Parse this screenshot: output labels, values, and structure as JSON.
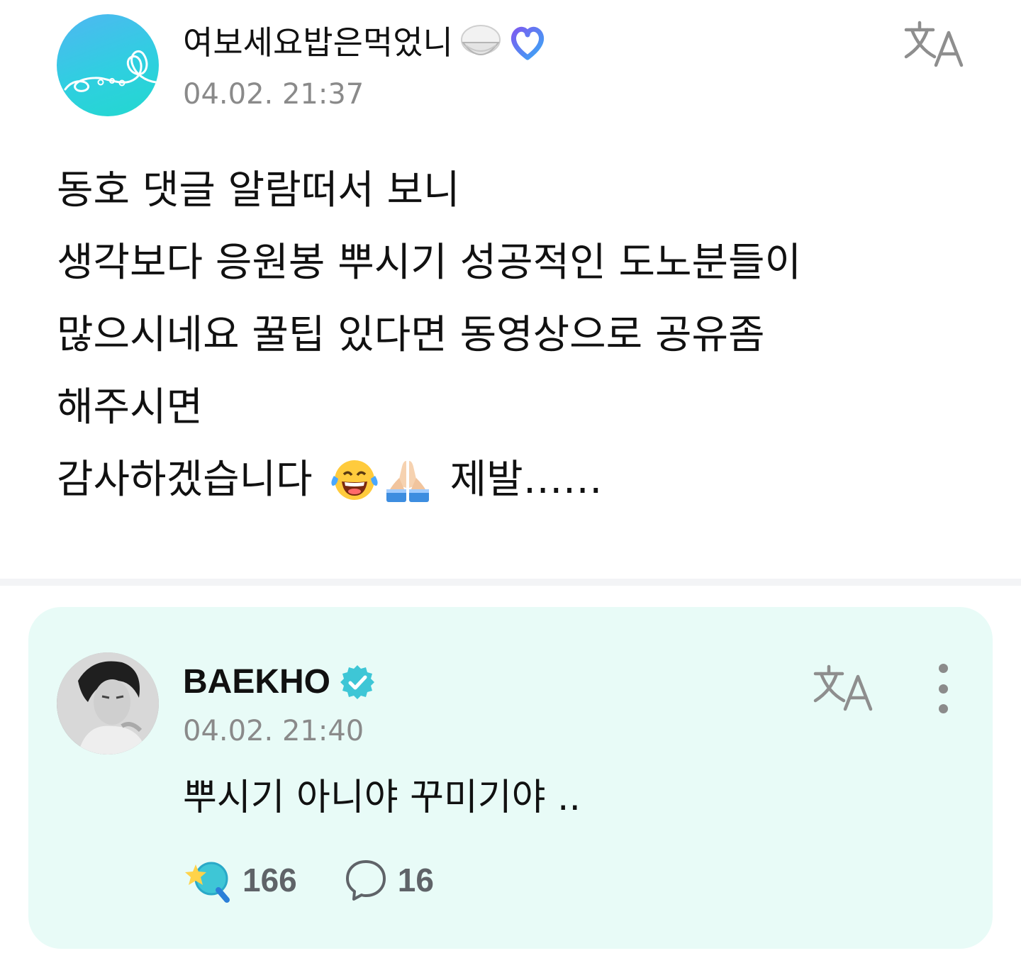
{
  "post": {
    "author": {
      "name": "여보세요밥은먹었니",
      "emoji": "rice-bowl-icon",
      "badge": "heart-badge-icon"
    },
    "timestamp": "04.02. 21:37",
    "translate_icon": "translate-icon",
    "lines": [
      "동호 댓글 알람떠서 보니",
      "생각보다 응원봉 뿌시기 성공적인 도노분들이",
      "많으시네요 꿀팁 있다면 동영상으로 공유좀",
      "해주시면"
    ],
    "last_line": {
      "before": "감사하겠습니다",
      "emojis": [
        "tears-of-joy-icon",
        "folded-hands-icon"
      ],
      "after": "제발……"
    }
  },
  "reply": {
    "author": {
      "name": "BAEKHO",
      "badge": "verified-icon"
    },
    "timestamp": "04.02. 21:40",
    "text": "뿌시기 아니야 꾸미기야 ..",
    "likes": "166",
    "comments": "16",
    "colors": {
      "card_bg": "#e8fbf7",
      "verified": "#3ec6d6"
    }
  }
}
